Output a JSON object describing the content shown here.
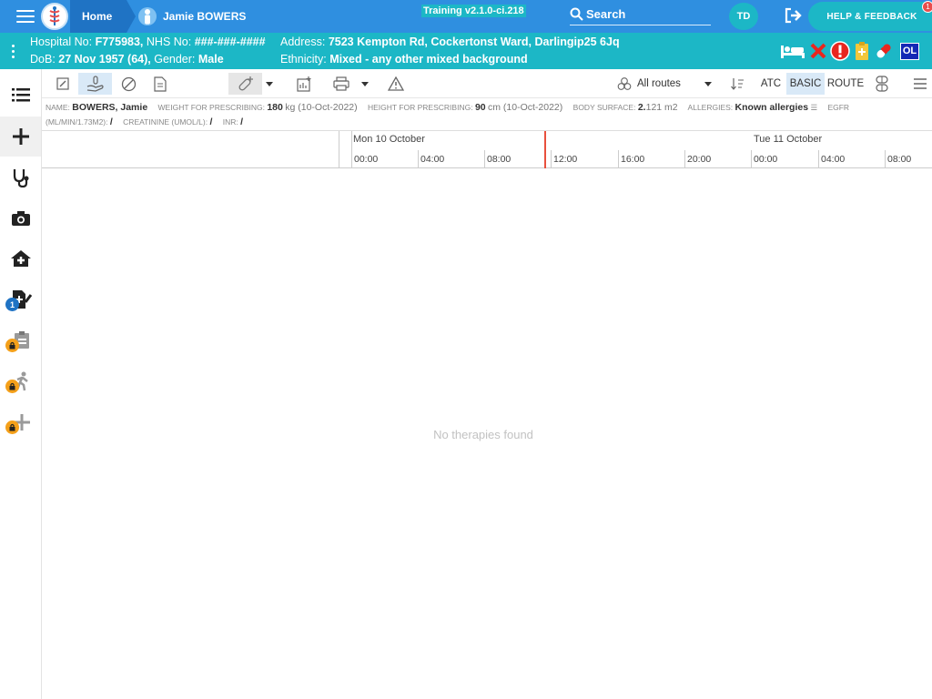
{
  "header": {
    "home_label": "Home",
    "patient_label": "Jamie BOWERS",
    "version": "Training v2.1.0-ci.218",
    "search_label": "Search",
    "user_initials": "TD",
    "help_label": "HELP & FEEDBACK",
    "help_badge": "1"
  },
  "banner": {
    "hospital_label": "Hospital No:",
    "hospital_no": "F775983,",
    "nhs_label": "NHS No:",
    "nhs_no": "###-###-####",
    "address_label": "Address:",
    "address": "7523 Kempton Rd, Cockertonst Ward, Darlingip25 6Jq",
    "dob_label": "DoB:",
    "dob": "27 Nov 1957 (64),",
    "gender_label": "Gender:",
    "gender": "Male",
    "ethnicity_label": "Ethnicity:",
    "ethnicity": "Mixed - any other mixed background",
    "ol_badge": "OL"
  },
  "sidebar": {
    "badge_count": "1"
  },
  "toolbar": {
    "routes_label": "All routes",
    "atc_label": "ATC",
    "basic_label": "BASIC",
    "route_label": "ROUTE"
  },
  "info": {
    "name_label": "NAME:",
    "name": "BOWERS, Jamie",
    "weight_label": "WEIGHT FOR PRESCRIBING:",
    "weight_value": "180",
    "weight_unit": "kg (10-Oct-2022)",
    "height_label": "HEIGHT FOR PRESCRIBING:",
    "height_value": "90",
    "height_unit": "cm (10-Oct-2022)",
    "bsa_label": "BODY SURFACE:",
    "bsa_value": "2.",
    "bsa_unit": "121 m2",
    "allergies_label": "ALLERGIES:",
    "allergies_value": "Known allergies",
    "egfr_label": "EGFR",
    "egfr_unit_label": "(ML/MIN/1.73M2):",
    "egfr_value": "/",
    "creatinine_label": "CREATININE (UMOL/L):",
    "creatinine_value": "/",
    "inr_label": "INR:",
    "inr_value": "/"
  },
  "timeline": {
    "day1": "Mon 10 October",
    "day2": "Tue 11 October",
    "ticks": [
      "00:00",
      "04:00",
      "08:00",
      "12:00",
      "16:00",
      "20:00",
      "00:00",
      "04:00",
      "08:00"
    ]
  },
  "empty_message": "No therapies found"
}
